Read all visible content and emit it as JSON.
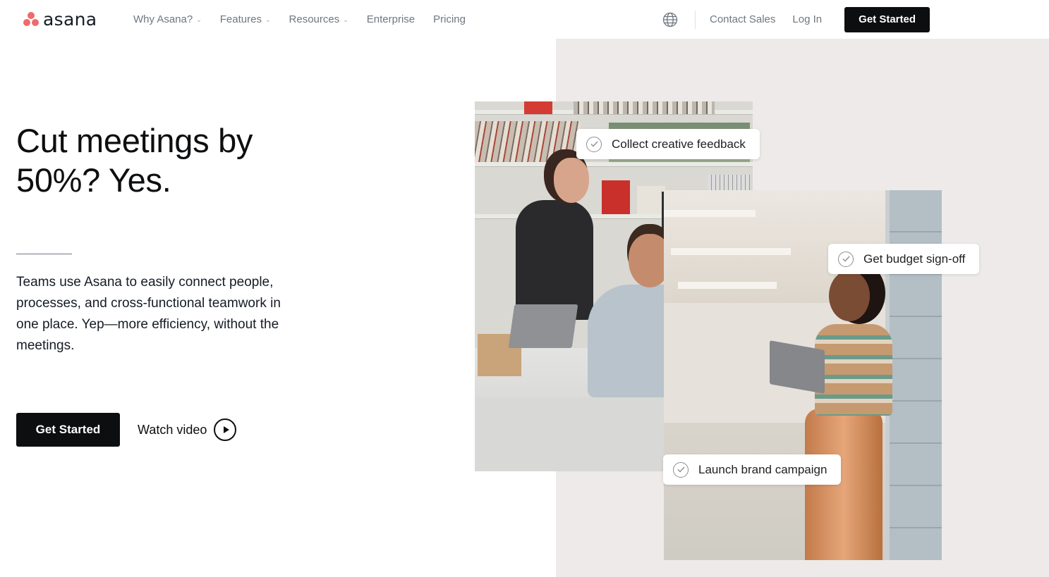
{
  "header": {
    "logo_text": "asana",
    "nav": [
      {
        "label": "Why Asana?",
        "has_dropdown": true
      },
      {
        "label": "Features",
        "has_dropdown": true
      },
      {
        "label": "Resources",
        "has_dropdown": true
      },
      {
        "label": "Enterprise",
        "has_dropdown": false
      },
      {
        "label": "Pricing",
        "has_dropdown": false
      }
    ],
    "globe_icon": "globe-icon",
    "contact_sales": "Contact Sales",
    "log_in": "Log In",
    "get_started": "Get Started"
  },
  "hero": {
    "title_line1": "Cut meetings by",
    "title_line2": "50%? Yes.",
    "body": "Teams use Asana to easily connect people, processes, and cross-functional teamwork in one place. Yep—more efficiency, without the meetings.",
    "cta_primary": "Get Started",
    "cta_secondary": "Watch video",
    "play_icon": "play-circle-icon"
  },
  "visual": {
    "tasks": [
      {
        "label": "Collect creative feedback",
        "icon": "check-circle-icon"
      },
      {
        "label": "Get budget sign-off",
        "icon": "check-circle-icon"
      },
      {
        "label": "Launch brand campaign",
        "icon": "check-circle-icon"
      }
    ]
  },
  "colors": {
    "brand_coral": "#f06a6a",
    "button_dark": "#0d0e10",
    "panel_bg": "#edeae9",
    "nav_text": "#6f7782"
  }
}
